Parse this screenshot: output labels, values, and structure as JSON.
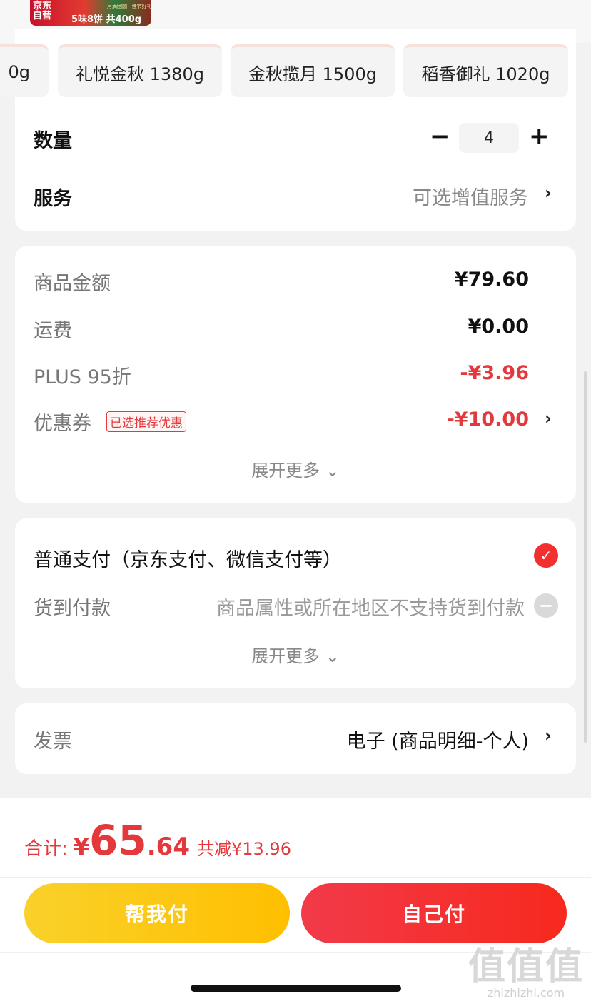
{
  "product_banner": {
    "logo_text": "京东自营",
    "spec_text": "5味8饼 共400g",
    "small_text": "月满团圆 · 佳节好礼"
  },
  "spec_options": [
    {
      "label": "0g"
    },
    {
      "label": "礼悦金秋  1380g"
    },
    {
      "label": "金秋揽月  1500g"
    },
    {
      "label": "稻香御礼  1020g"
    }
  ],
  "quantity": {
    "label": "数量",
    "minus": "−",
    "value": "4",
    "plus": "+"
  },
  "service": {
    "label": "服务",
    "hint": "可选增值服务",
    "chevron": "›"
  },
  "price_summary": {
    "goods_label": "商品金额",
    "goods_amount": "¥79.60",
    "shipping_label": "运费",
    "shipping_amount": "¥0.00",
    "plus_label": "PLUS 95折",
    "plus_amount": "-¥3.96",
    "coupon_label": "优惠券",
    "coupon_tag": "已选推荐优惠",
    "coupon_amount": "-¥10.00",
    "chevron": "›",
    "expand_label": "展开更多 ⌄"
  },
  "payment": {
    "normal_label": "普通支付（京东支付、微信支付等）",
    "normal_check": "✓",
    "cod_label": "货到付款",
    "cod_note": "商品属性或所在地区不支持货到付款",
    "cod_disabled": "−",
    "expand_label": "展开更多 ⌄"
  },
  "invoice": {
    "label": "发票",
    "value": "电子 (商品明细-个人)",
    "chevron": "›"
  },
  "footer": {
    "total_label": "合计:",
    "total_yen": "¥",
    "total_int": "65",
    "total_dec": ".64",
    "saved_text": "共减¥13.96",
    "help_pay_label": "帮我付",
    "self_pay_label": "自己付"
  },
  "watermark": {
    "big": "值值值",
    "small": "zhizhizhi.com"
  },
  "colors": {
    "accent_red": "#e4393c",
    "help_button": "#ffbf00",
    "self_button": "#f7291d"
  }
}
